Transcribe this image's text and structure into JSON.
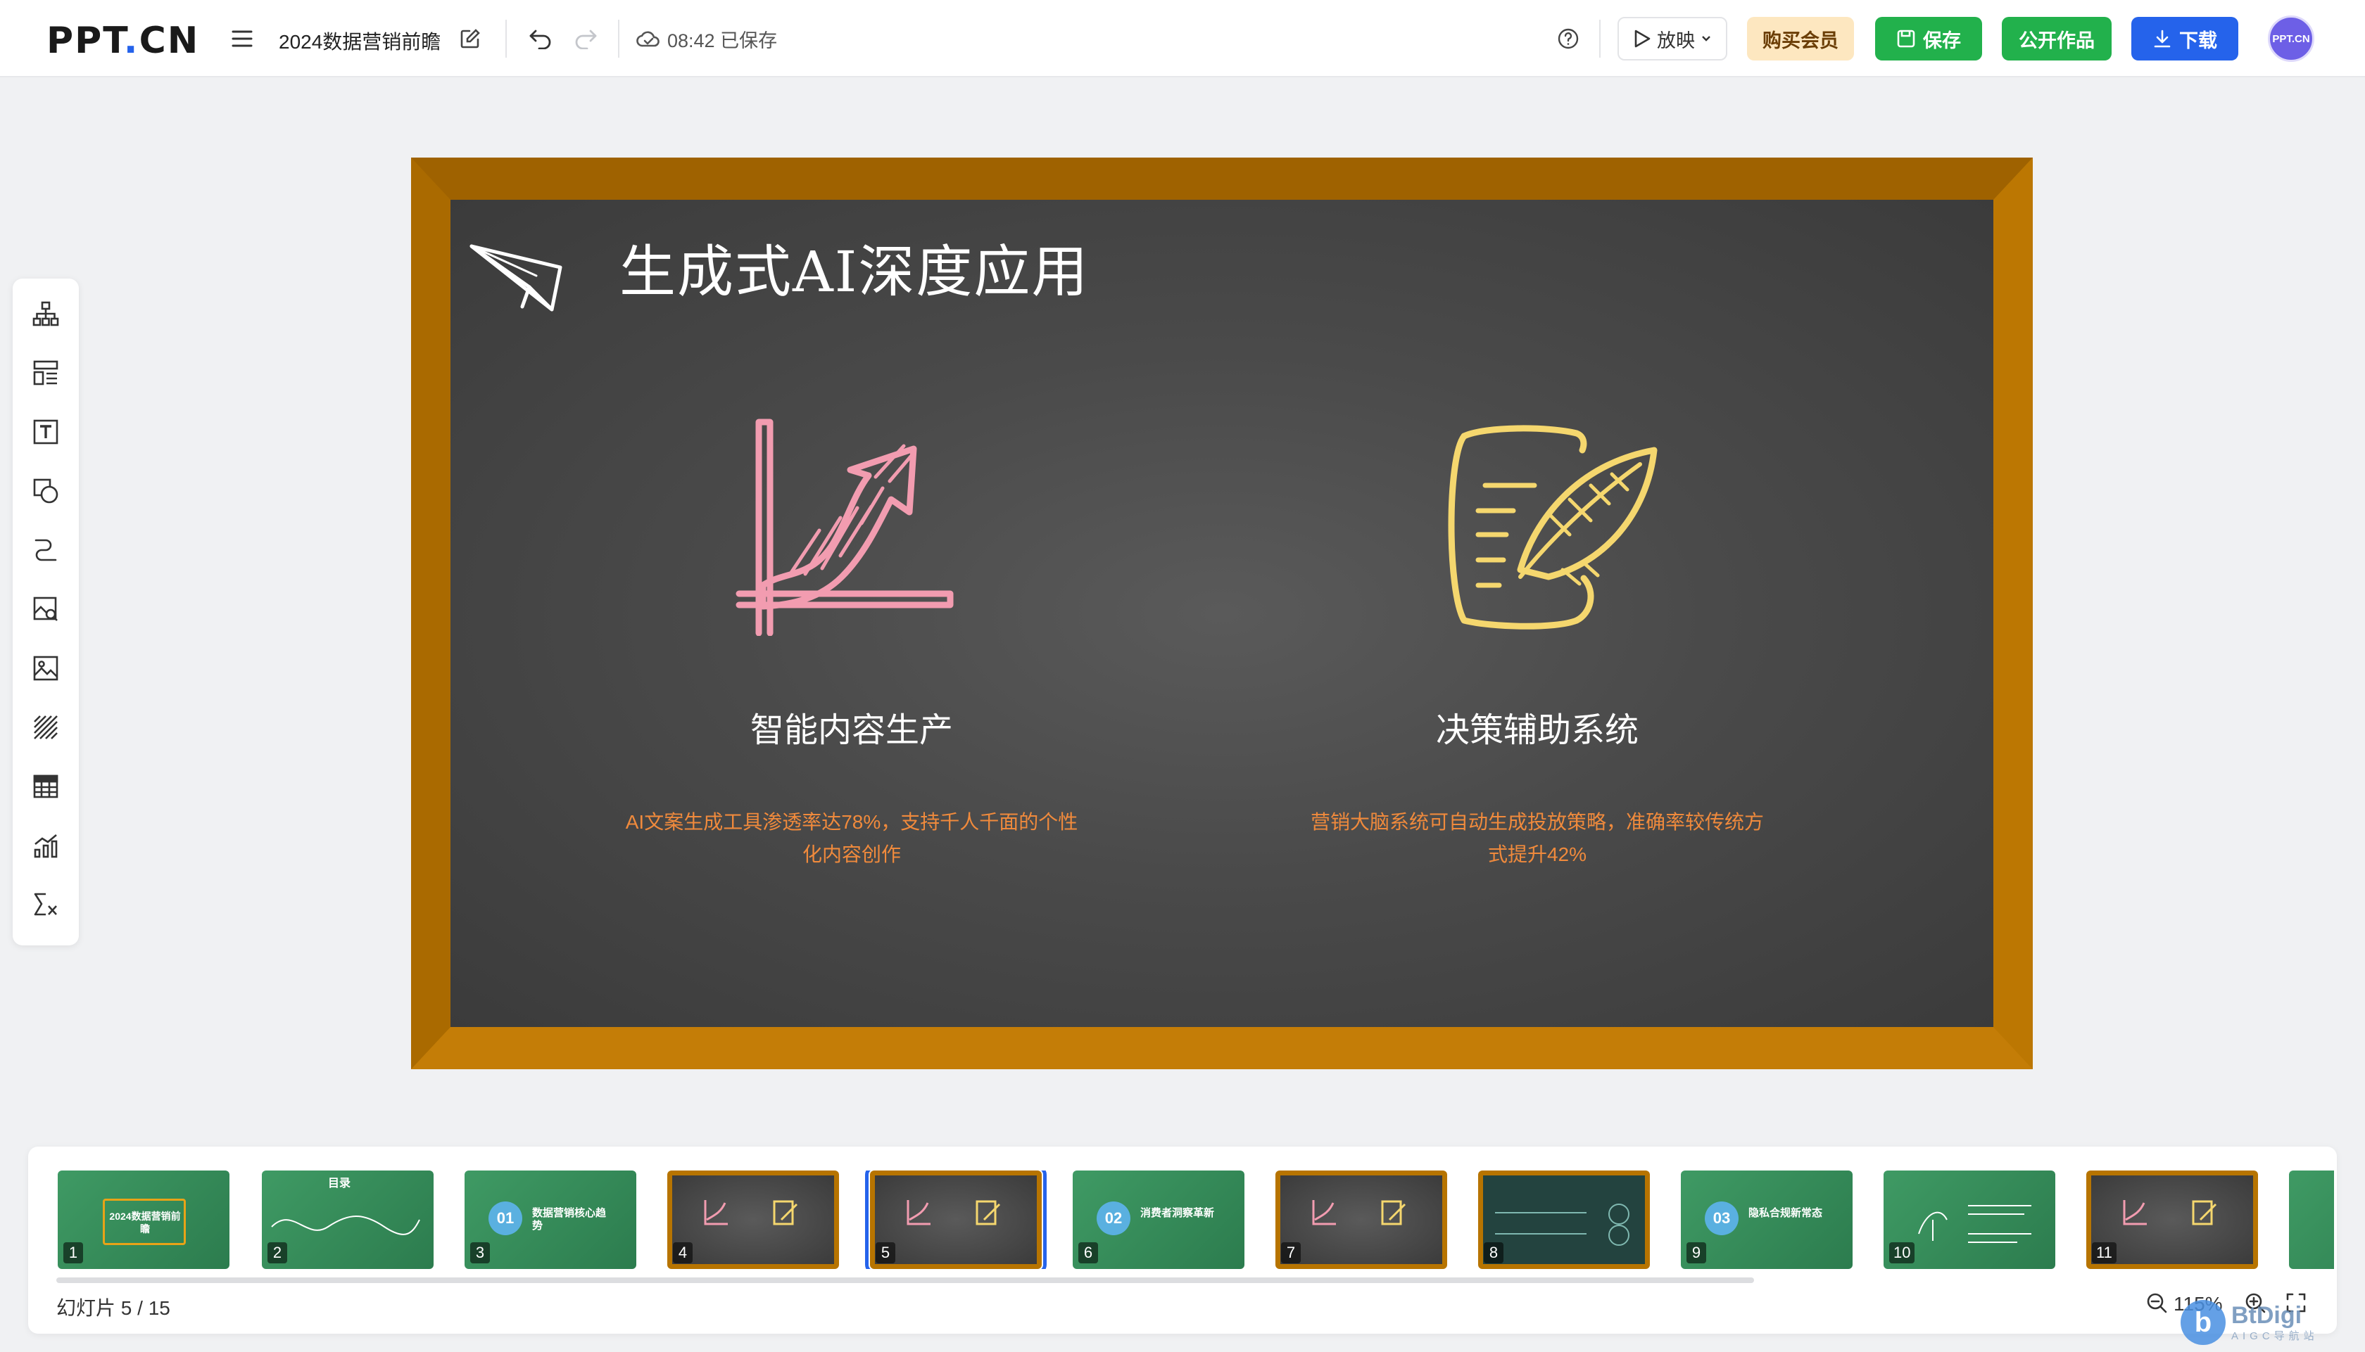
{
  "app": {
    "logo": "PPT.CN",
    "doc_title": "2024数据营销前瞻",
    "save_time": "08:42 已保存"
  },
  "toolbar": {
    "play_label": "放映",
    "vip_label": "购买会员",
    "save_label": "保存",
    "publish_label": "公开作品",
    "download_label": "下载",
    "avatar_text": "PPT.CN"
  },
  "left_tools": [
    {
      "icon": "org-chart-icon"
    },
    {
      "icon": "layout-icon"
    },
    {
      "icon": "text-box-icon"
    },
    {
      "icon": "shapes-icon"
    },
    {
      "icon": "line-icon"
    },
    {
      "icon": "image-search-icon"
    },
    {
      "icon": "image-icon"
    },
    {
      "icon": "pattern-icon"
    },
    {
      "icon": "table-icon"
    },
    {
      "icon": "chart-icon"
    },
    {
      "icon": "formula-icon"
    }
  ],
  "slide": {
    "title": "生成式AI深度应用",
    "left": {
      "heading": "智能内容生产",
      "body_line1": "AI文案生成工具渗透率达78%，支持千人千面的个性",
      "body_line2": "化内容创作"
    },
    "right": {
      "heading": "决策辅助系统",
      "body_line1": "营销大脑系统可自动生成投放策略，准确率较传统方",
      "body_line2": "式提升42%"
    },
    "colors": {
      "frame": "#b77400",
      "board": "#4a4a4a",
      "left_icon": "#f29cb0",
      "right_icon": "#f5d76e",
      "body_text": "#f08a3c"
    }
  },
  "thumbnails": [
    {
      "num": "1",
      "text": "2024数据营销前瞻"
    },
    {
      "num": "2",
      "text": "目录"
    },
    {
      "num": "3",
      "text": "数据营销核心趋势"
    },
    {
      "num": "4",
      "text": ""
    },
    {
      "num": "5",
      "text": ""
    },
    {
      "num": "6",
      "text": "消费者洞察革新"
    },
    {
      "num": "7",
      "text": ""
    },
    {
      "num": "8",
      "text": ""
    },
    {
      "num": "9",
      "text": "隐私合规新常态"
    },
    {
      "num": "10",
      "text": ""
    },
    {
      "num": "11",
      "text": ""
    }
  ],
  "footer": {
    "slide_counter": "幻灯片 5 / 15",
    "zoom": "115%"
  },
  "watermark": {
    "main": "BtDigi",
    "sub": "AIGC导航站"
  }
}
